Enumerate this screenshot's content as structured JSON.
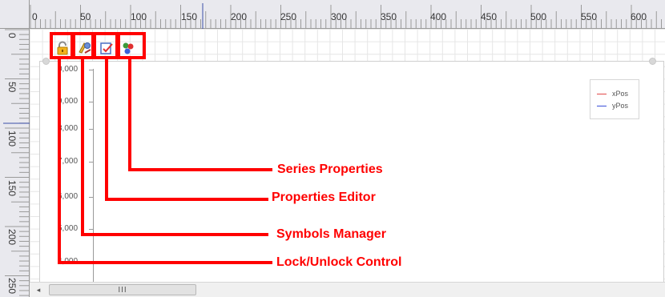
{
  "ruler": {
    "horizontal_labels": [
      "0",
      "50",
      "100",
      "150",
      "200",
      "250",
      "300",
      "350",
      "400",
      "450",
      "500",
      "550",
      "600"
    ],
    "vertical_labels": [
      "0",
      "50",
      "100",
      "150",
      "200",
      "250"
    ]
  },
  "toolbar": {
    "buttons": [
      {
        "name": "lock-unlock-control",
        "icon": "lock-icon"
      },
      {
        "name": "symbols-manager",
        "icon": "symbols-icon"
      },
      {
        "name": "properties-editor",
        "icon": "properties-editor-icon"
      },
      {
        "name": "series-properties",
        "icon": "series-properties-icon"
      }
    ]
  },
  "chart": {
    "y_tick_labels": [
      "0,000",
      "9,000",
      "8,000",
      "7,000",
      "6,000",
      "5,000",
      "4,000"
    ],
    "legend": [
      {
        "label": "xPos",
        "color": "#e24a4a"
      },
      {
        "label": "yPos",
        "color": "#3a4fd8"
      }
    ]
  },
  "annotations": {
    "callouts": [
      {
        "label": "Series Properties"
      },
      {
        "label": "Properties Editor"
      },
      {
        "label": "Symbols Manager"
      },
      {
        "label": "Lock/Unlock Control"
      }
    ],
    "color": "#ff0000"
  },
  "scrollbar": {
    "left_arrow": "◂",
    "thumb_grip": "III"
  }
}
